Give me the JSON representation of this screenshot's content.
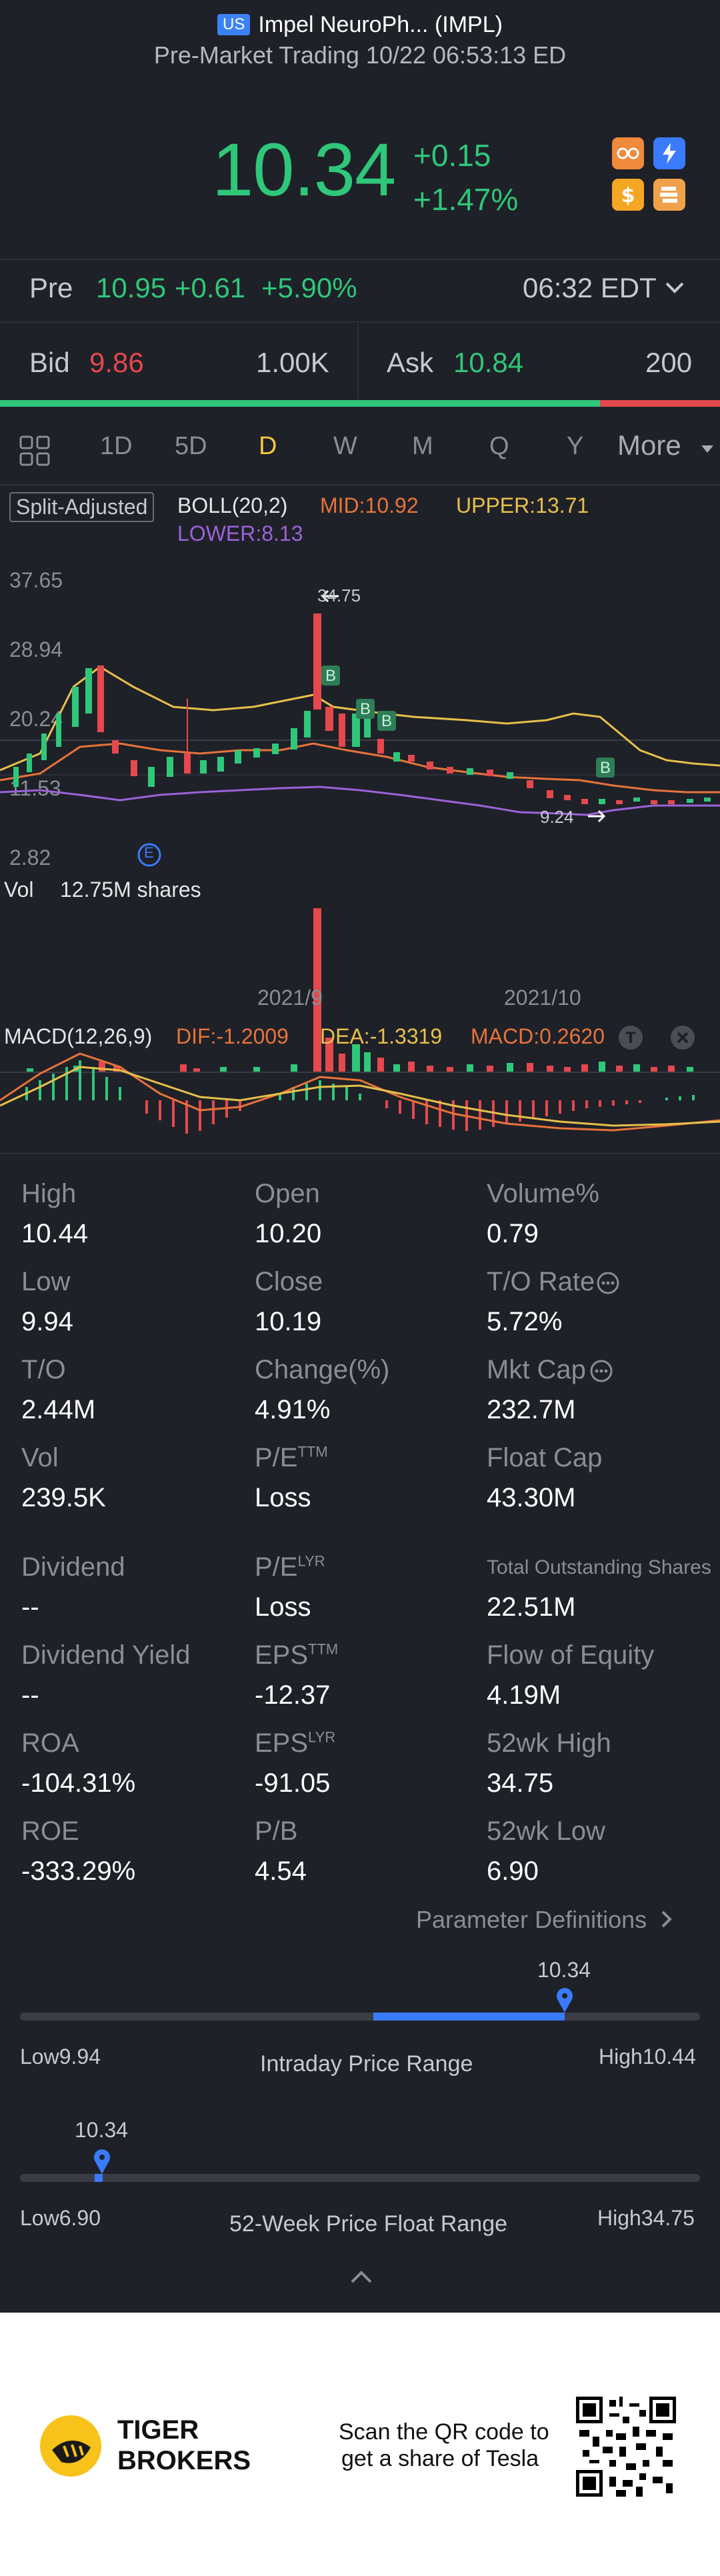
{
  "header": {
    "market_badge": "US",
    "stock_title": "Impel NeuroPh... (IMPL)",
    "session_text": "Pre-Market Trading 10/22 06:53:13 ED",
    "price": "10.34",
    "change": "+0.15",
    "change_pct": "+1.47%"
  },
  "pre": {
    "label": "Pre",
    "price": "10.95",
    "change": "+0.61",
    "change_pct": "+5.90%",
    "time": "06:32 EDT"
  },
  "quote": {
    "bid_label": "Bid",
    "bid_price": "9.86",
    "bid_size": "1.00K",
    "ask_label": "Ask",
    "ask_price": "10.84",
    "ask_size": "200"
  },
  "colors": {
    "up": "#2fc77a",
    "down": "#e5484d",
    "accent": "#f5c542",
    "blue": "#3a7bfd"
  },
  "tabs": [
    "1D",
    "5D",
    "D",
    "W",
    "M",
    "Q",
    "Y"
  ],
  "tabs_more": "More",
  "indicators": {
    "split_adjusted": "Split-Adjusted",
    "boll": "BOLL(20,2)",
    "mid": "MID:10.92",
    "upper": "UPPER:13.71",
    "lower": "LOWER:8.13"
  },
  "chart_data": {
    "type": "candlestick",
    "y_ticks": [
      "37.65",
      "28.94",
      "20.24",
      "11.53",
      "2.82"
    ],
    "x_ticks": [
      "2021/9",
      "2021/10"
    ],
    "high_marker": "34.75",
    "low_marker": "9.24",
    "event_marker": "E",
    "buy_marker": "B",
    "volume_label": "Vol",
    "volume_value": "12.75M shares",
    "macd_label": "MACD(12,26,9)",
    "dif": "DIF:-1.2009",
    "dea": "DEA:-1.3319",
    "macd": "MACD:0.2620"
  },
  "stats": [
    {
      "label": "High",
      "value": "10.44"
    },
    {
      "label": "Open",
      "value": "10.20"
    },
    {
      "label": "Volume%",
      "value": "0.79"
    },
    {
      "label": "Low",
      "value": "9.94"
    },
    {
      "label": "Close",
      "value": "10.19"
    },
    {
      "label": "T/O Rate",
      "value": "5.72%"
    },
    {
      "label": "T/O",
      "value": "2.44M"
    },
    {
      "label": "Change(%)",
      "value": "4.91%"
    },
    {
      "label": "Mkt Cap",
      "value": "232.7M"
    },
    {
      "label": "Vol",
      "value": "239.5K"
    },
    {
      "label": "P/E",
      "sup": "TTM",
      "value": "Loss"
    },
    {
      "label": "Float Cap",
      "value": "43.30M"
    },
    {
      "label": "Dividend",
      "value": "--"
    },
    {
      "label": "P/E",
      "sup": "LYR",
      "value": "Loss"
    },
    {
      "label": "Total Outstanding Shares",
      "value": "22.51M"
    },
    {
      "label": "Dividend Yield",
      "value": "--"
    },
    {
      "label": "EPS",
      "sup": "TTM",
      "value": "-12.37"
    },
    {
      "label": "Flow of Equity",
      "value": "4.19M"
    },
    {
      "label": "ROA",
      "value": "-104.31%"
    },
    {
      "label": "EPS",
      "sup": "LYR",
      "value": "-91.05"
    },
    {
      "label": "52wk High",
      "value": "34.75"
    },
    {
      "label": "ROE",
      "value": "-333.29%"
    },
    {
      "label": "P/B",
      "value": "4.54"
    },
    {
      "label": "52wk Low",
      "value": "6.90"
    }
  ],
  "param_defs": "Parameter Definitions",
  "intraday": {
    "current": "10.34",
    "low_label": "Low",
    "low": "9.94",
    "high_label": "High",
    "high": "10.44",
    "title": "Intraday Price Range",
    "position": 0.8
  },
  "week52": {
    "current": "10.34",
    "low_label": "Low",
    "low": "6.90",
    "high_label": "High",
    "high": "34.75",
    "title": "52-Week Price Float Range",
    "position": 0.123
  },
  "footer": {
    "brand_line1": "TIGER",
    "brand_line2": "BROKERS",
    "scan_line1": "Scan the QR code to",
    "scan_line2": "get a share of Tesla"
  }
}
